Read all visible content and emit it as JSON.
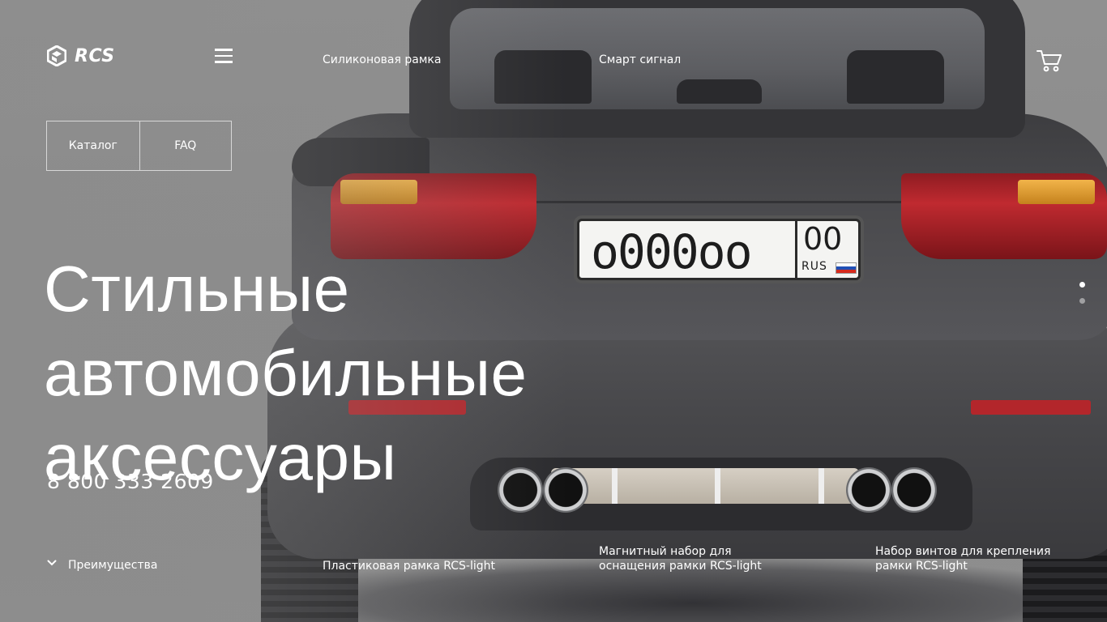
{
  "brand": {
    "name": "RCS"
  },
  "nav": {
    "top_links": [
      "Силиконовая рамка",
      "Смарт сигнал"
    ],
    "menu_icon": "hamburger-menu-icon",
    "cart_icon": "shopping-cart-icon"
  },
  "buttons": {
    "catalog": "Каталог",
    "faq": "FAQ"
  },
  "hero": {
    "title_lines": [
      "Стильные",
      "автомобильные",
      "аксессуары"
    ],
    "phone": "8 800 333 2609",
    "image": {
      "plate_number": "о000оо",
      "plate_region": "00",
      "plate_country": "RUS"
    }
  },
  "advantages": {
    "label": "Преимущества",
    "icon": "chevron-down-icon"
  },
  "bottom_links": [
    "Пластиковая рамка RCS-light",
    "Магнитный набор для оснащения рамки RCS-light",
    "Набор винтов для крепления рамки RCS-light"
  ],
  "slider": {
    "count": 2,
    "active": 0
  },
  "colors": {
    "text": "#ffffff",
    "background": "#8e8e8e",
    "car_body": "#47474a",
    "tail_light": "#c02a30"
  }
}
